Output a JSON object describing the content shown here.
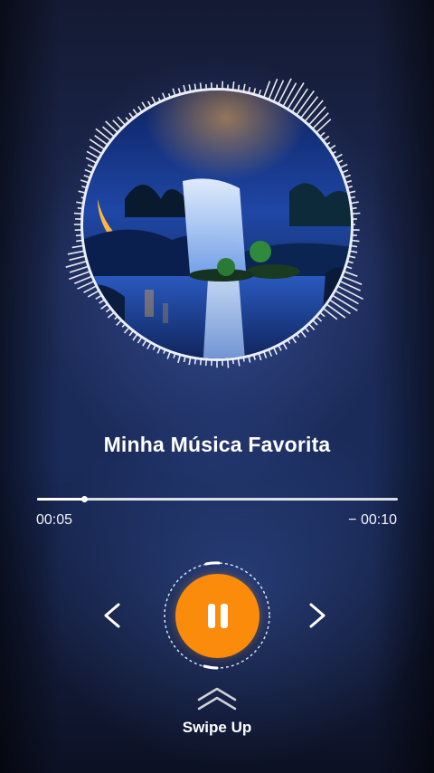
{
  "player": {
    "song_title": "Minha Música Favorita",
    "time_elapsed": "00:05",
    "time_remaining": "− 00:10",
    "progress_fraction": 0.13,
    "state": "playing"
  },
  "album_art": {
    "visualizer": "circular-audio-spectrum"
  },
  "controls": {
    "previous_icon": "chevron-left-icon",
    "play_pause_icon": "pause-icon",
    "next_icon": "chevron-right-icon"
  },
  "swipe": {
    "label": "Swipe Up",
    "icon": "double-chevron-up-icon"
  },
  "colors": {
    "accent": "#fb8c0b",
    "background": "#1d2a55",
    "text": "#ffffff"
  }
}
